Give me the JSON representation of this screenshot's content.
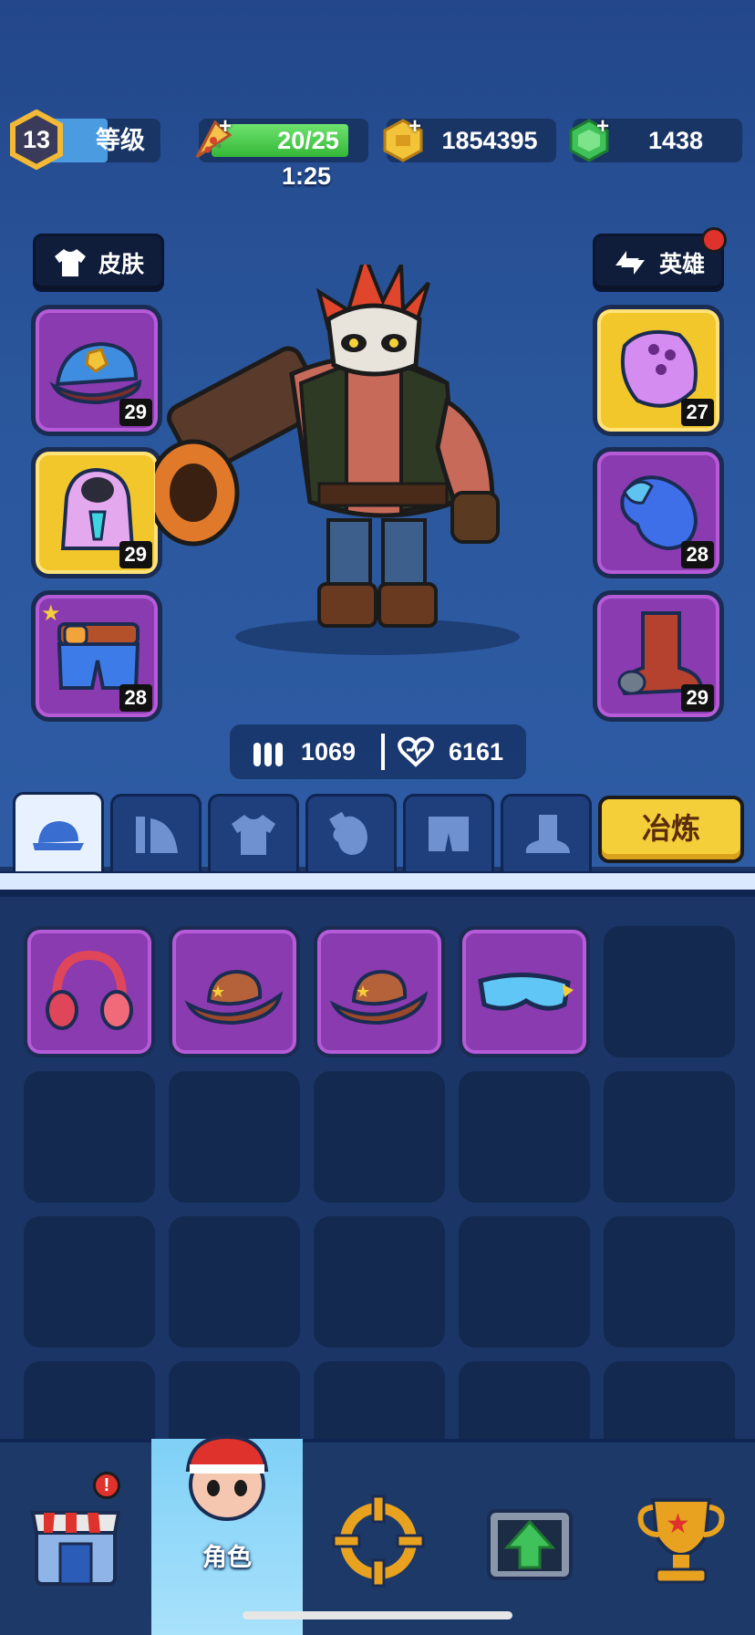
{
  "header": {
    "level": "13",
    "level_label": "等级",
    "energy": "20/25",
    "energy_timer": "1:25",
    "coins": "1854395",
    "gems": "1438"
  },
  "buttons": {
    "skin_label": "皮肤",
    "hero_label": "英雄",
    "smelt_label": "冶炼"
  },
  "equipment_left": [
    {
      "name": "police-cap",
      "level": "29"
    },
    {
      "name": "hoodie",
      "level": "29"
    },
    {
      "name": "shorts",
      "level": "28"
    }
  ],
  "equipment_right": [
    {
      "name": "knuckle",
      "level": "27"
    },
    {
      "name": "glove",
      "level": "28"
    },
    {
      "name": "boot",
      "level": "29"
    }
  ],
  "stats": {
    "ammo": "1069",
    "health": "6161"
  },
  "inventory": [
    "headphones",
    "cowboy-hat",
    "cowboy-hat",
    "goggles"
  ],
  "nav": {
    "active_label": "角色"
  },
  "colors": {
    "epic_purple": "#8a3bb0",
    "legendary_gold": "#f2c72c",
    "background": "#1a3566"
  }
}
